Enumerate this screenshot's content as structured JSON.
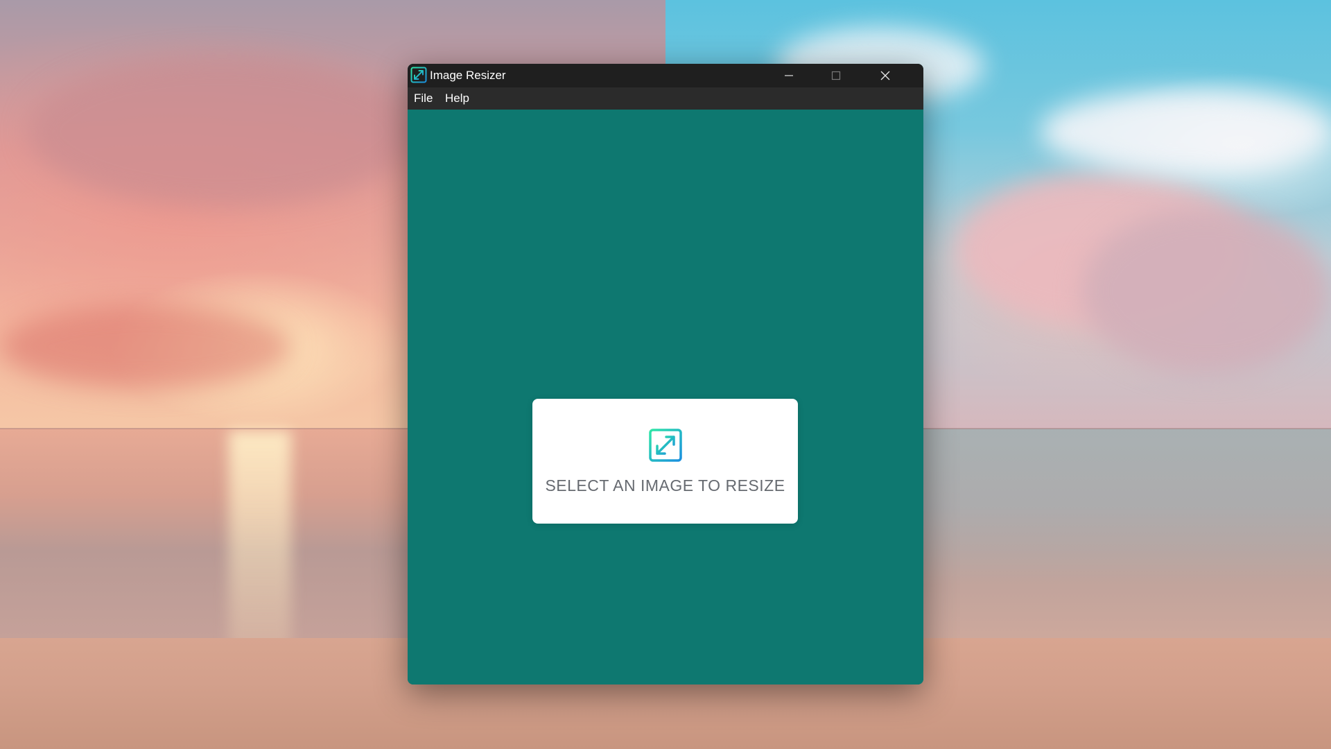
{
  "window": {
    "title": "Image Resizer",
    "icon": "resize-icon",
    "controls": [
      "minimize-icon",
      "maximize-icon",
      "close-icon"
    ]
  },
  "menubar": {
    "items": [
      {
        "label": "File"
      },
      {
        "label": "Help"
      }
    ]
  },
  "main": {
    "card_label": "SELECT AN IMAGE TO RESIZE",
    "card_icon": "resize-icon"
  },
  "colors": {
    "app_background": "#0e7870",
    "titlebar": "#1f1f1f",
    "menubar": "#2b2b2b",
    "card": "#ffffff",
    "card_text": "#666a70",
    "icon_gradient_start": "#2ee6a6",
    "icon_gradient_end": "#1a8fe0"
  }
}
